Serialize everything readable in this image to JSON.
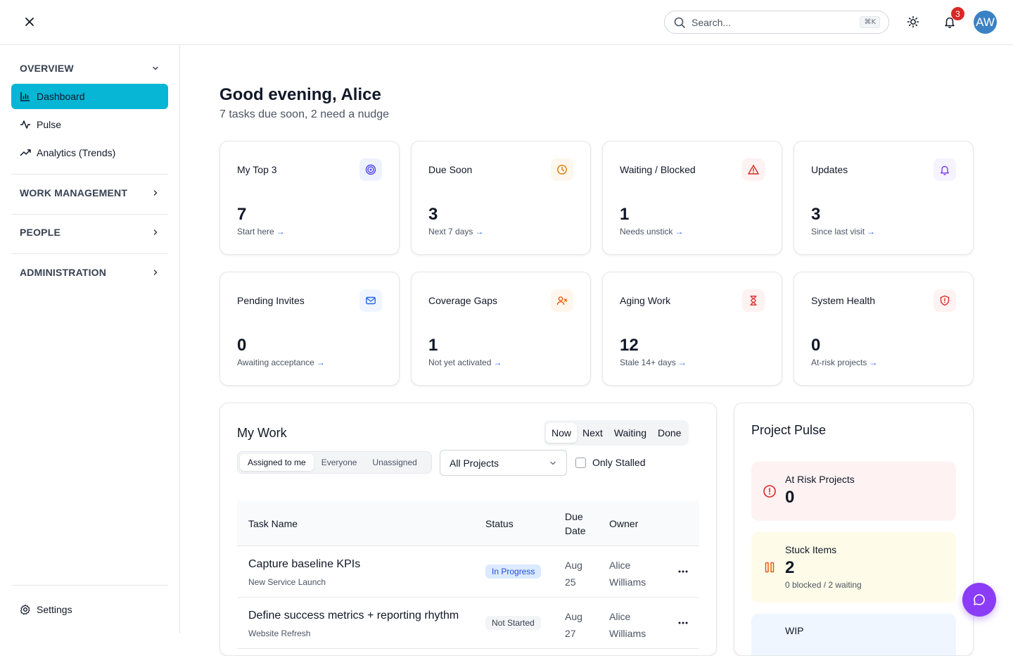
{
  "topbar": {
    "search_placeholder": "Search...",
    "search_shortcut": "⌘K",
    "notification_count": "3",
    "avatar_initials": "AW"
  },
  "sidebar": {
    "overview_label": "OVERVIEW",
    "items": [
      {
        "label": "Dashboard",
        "icon": "bar-chart-icon",
        "active": true
      },
      {
        "label": "Pulse",
        "icon": "activity-icon",
        "active": false
      },
      {
        "label": "Analytics (Trends)",
        "icon": "trending-up-icon",
        "active": false
      }
    ],
    "sections": [
      "WORK MANAGEMENT",
      "PEOPLE",
      "ADMINISTRATION"
    ],
    "settings_label": "Settings",
    "accent_color": "#06b6d4"
  },
  "header": {
    "greeting": "Good evening, Alice",
    "subtitle": "7 tasks due soon, 2 need a nudge"
  },
  "cards": [
    {
      "title": "My Top 3",
      "value": "7",
      "sub": "Start here",
      "icon": "target-icon"
    },
    {
      "title": "Due Soon",
      "value": "3",
      "sub": "Next 7 days",
      "icon": "clock-icon"
    },
    {
      "title": "Waiting / Blocked",
      "value": "1",
      "sub": "Needs unstick",
      "icon": "alert-triangle-icon"
    },
    {
      "title": "Updates",
      "value": "3",
      "sub": "Since last visit",
      "icon": "bell-icon"
    },
    {
      "title": "Pending Invites",
      "value": "0",
      "sub": "Awaiting acceptance",
      "icon": "mail-icon"
    },
    {
      "title": "Coverage Gaps",
      "value": "1",
      "sub": "Not yet activated",
      "icon": "user-x-icon"
    },
    {
      "title": "Aging Work",
      "value": "12",
      "sub": "Stale 14+ days",
      "icon": "hourglass-icon"
    },
    {
      "title": "System Health",
      "value": "0",
      "sub": "At-risk projects",
      "icon": "shield-alert-icon"
    }
  ],
  "card_arrow": "→",
  "my_work": {
    "title": "My Work",
    "tabs": [
      "Now",
      "Next",
      "Waiting",
      "Done"
    ],
    "active_tab": "Now",
    "filters": [
      "Assigned to me",
      "Everyone",
      "Unassigned"
    ],
    "active_filter": "Assigned to me",
    "project_select": "All Projects",
    "only_stalled_label": "Only Stalled",
    "columns": [
      "Task Name",
      "Status",
      "Due Date",
      "Owner"
    ],
    "rows": [
      {
        "name": "Capture baseline KPIs",
        "project": "New Service Launch",
        "status": "In Progress",
        "due": "Aug 25",
        "owner": "Alice Williams"
      },
      {
        "name": "Define success metrics + reporting rhythm",
        "project": "Website Refresh",
        "status": "Not Started",
        "due": "Aug 27",
        "owner": "Alice Williams"
      }
    ]
  },
  "project_pulse": {
    "title": "Project Pulse",
    "at_risk": {
      "label": "At Risk Projects",
      "value": "0"
    },
    "stuck": {
      "label": "Stuck Items",
      "value": "2",
      "sub": "0 blocked / 2 waiting"
    },
    "wip": {
      "label": "WIP"
    }
  }
}
